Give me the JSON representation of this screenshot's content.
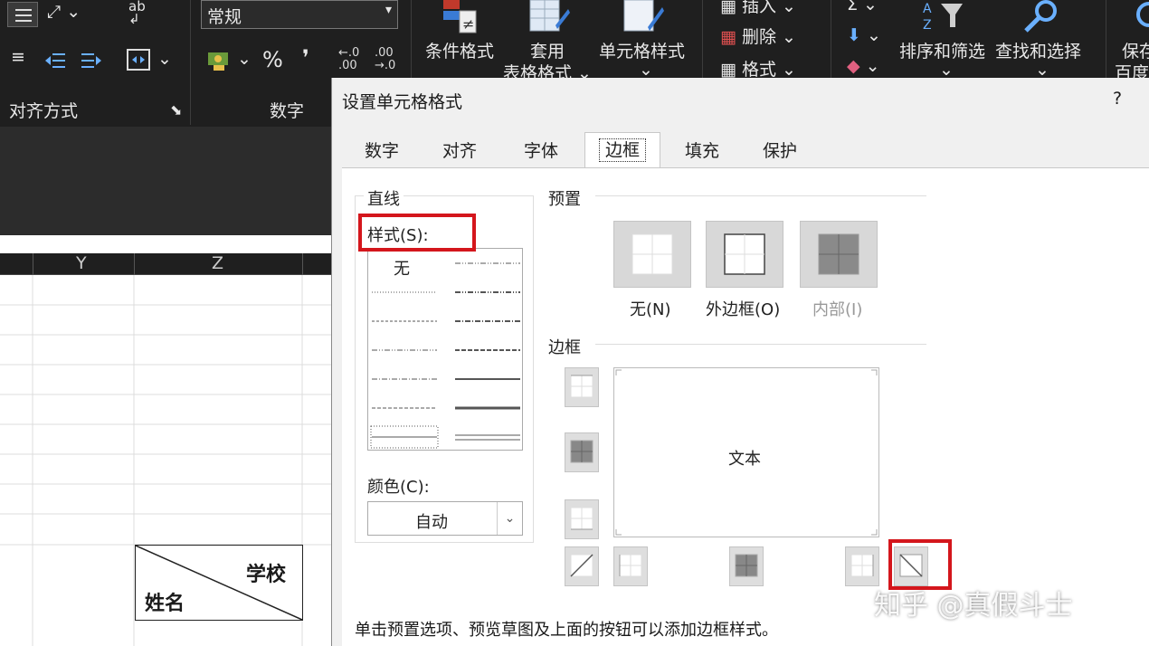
{
  "ribbon": {
    "number_format_value": "常规",
    "align_group_label": "对齐方式",
    "number_group_label": "数字",
    "percent_symbol": "%",
    "comma_symbol": "❜",
    "conditional_format_label": "条件格式",
    "table_format_label_1": "套用",
    "table_format_label_2": "表格格式",
    "cell_style_label": "单元格样式",
    "insert_label": "插入",
    "delete_label": "删除",
    "format_label": "格式",
    "sort_filter_label": "排序和筛选",
    "find_select_label": "查找和选择",
    "save_label_1": "保存",
    "save_label_2": "百度",
    "increase_decimal_top": "←.0",
    "increase_decimal_bottom": ".00",
    "decrease_decimal_top": ".00",
    "decrease_decimal_bottom": "→.0"
  },
  "sheet": {
    "columns": [
      "Y",
      "Z"
    ],
    "cell_top_right": "学校",
    "cell_bottom_left": "姓名"
  },
  "dialog": {
    "title": "设置单元格格式",
    "help": "?",
    "tabs": [
      "数字",
      "对齐",
      "字体",
      "边框",
      "填充",
      "保护"
    ],
    "active_tab": "边框",
    "line_group": "直线",
    "style_label": "样式(S):",
    "style_none": "无",
    "color_label": "颜色(C):",
    "color_value": "自动",
    "preset_group": "预置",
    "presets": [
      "无(N)",
      "外边框(O)",
      "内部(I)"
    ],
    "border_group": "边框",
    "preview_text": "文本",
    "hint": "单击预置选项、预览草图及上面的按钮可以添加边框样式。"
  },
  "watermark": "知乎 @真假斗士",
  "colors": {
    "ribbon_bg": "#1f1f1f",
    "dialog_bg": "#f0f0f0",
    "highlight": "#d4161c"
  }
}
